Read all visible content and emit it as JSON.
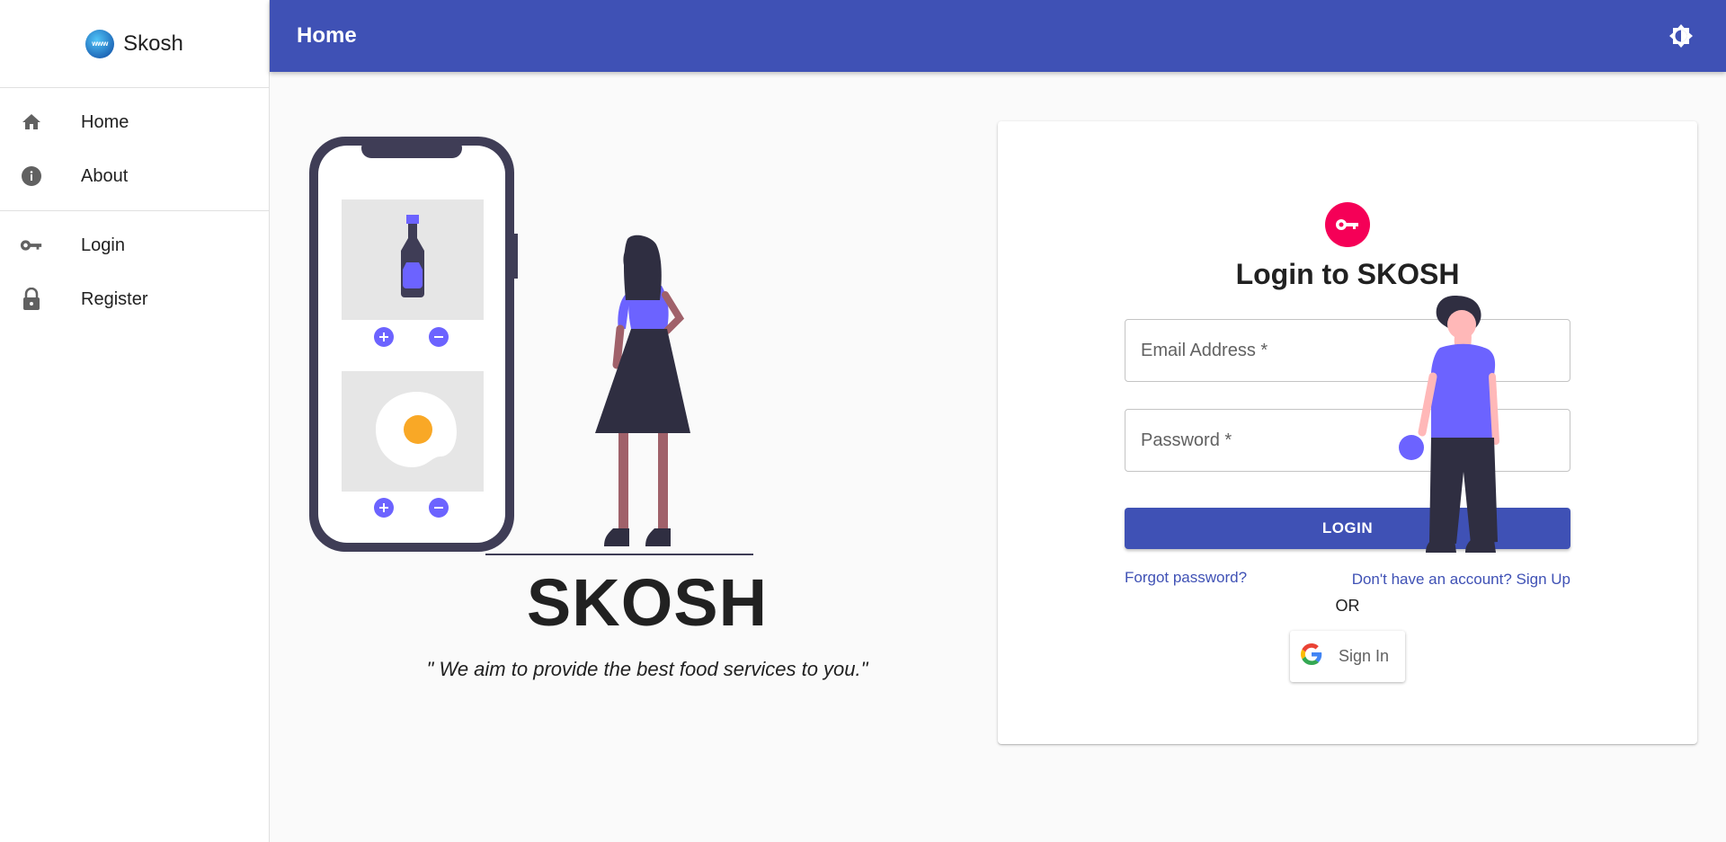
{
  "sidebar": {
    "brand": {
      "logo_text": "www",
      "name": "Skosh"
    },
    "groups": [
      {
        "items": [
          {
            "label": "Home",
            "icon": "home-icon"
          },
          {
            "label": "About",
            "icon": "info-icon"
          }
        ]
      },
      {
        "items": [
          {
            "label": "Login",
            "icon": "key-icon"
          },
          {
            "label": "Register",
            "icon": "lock-icon"
          }
        ]
      }
    ]
  },
  "appbar": {
    "title": "Home",
    "theme_icon": "brightness-icon"
  },
  "hero": {
    "title": "SKOSH",
    "tagline": "\" We aim to provide the best food services to you.\""
  },
  "login": {
    "avatar_icon": "key-icon",
    "title": "Login to SKOSH",
    "email_label": "Email Address *",
    "password_label": "Password *",
    "login_button": "LOGIN",
    "forgot_link": "Forgot password?",
    "signup_link": "Don't have an account? Sign Up",
    "or_text": "OR",
    "google_button": "Sign In"
  },
  "colors": {
    "primary": "#3f51b5",
    "secondary": "#f50057",
    "illustration_accent": "#6c63ff",
    "illustration_dark": "#2f2e41"
  }
}
